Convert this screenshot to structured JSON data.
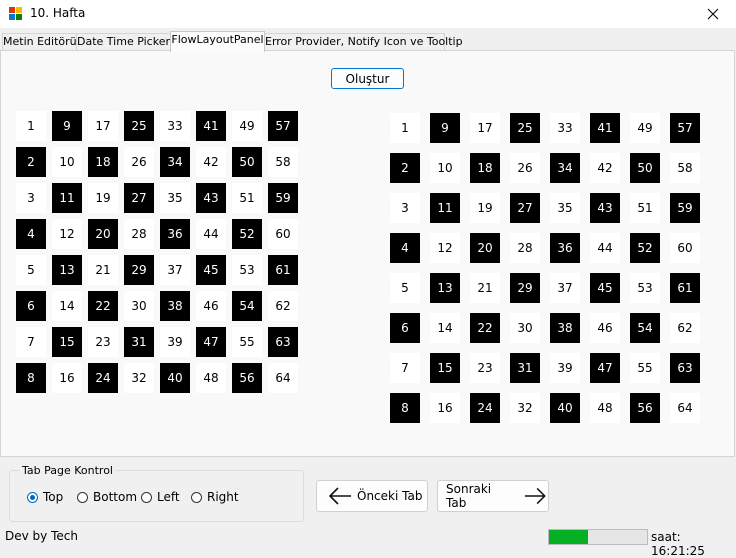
{
  "window": {
    "title": "10. Hafta"
  },
  "tabs": [
    {
      "label": "Metin Editörü",
      "selected": false
    },
    {
      "label": "Date Time Picker",
      "selected": false
    },
    {
      "label": "FlowLayoutPanel",
      "selected": true
    },
    {
      "label": "Error Provider, Notify Icon ve Tooltip",
      "selected": false
    }
  ],
  "panel": {
    "create_button": "Oluştur",
    "left_grid": {
      "count": 64,
      "dark_numbers": [
        2,
        4,
        6,
        8,
        9,
        11,
        13,
        15,
        18,
        20,
        22,
        24,
        25,
        27,
        29,
        31,
        34,
        36,
        38,
        40,
        41,
        43,
        45,
        47,
        50,
        52,
        54,
        56,
        57,
        59,
        61,
        63
      ]
    },
    "right_grid": {
      "count": 64,
      "dark_numbers": [
        2,
        4,
        6,
        8,
        9,
        11,
        13,
        15,
        18,
        20,
        22,
        24,
        25,
        27,
        29,
        31,
        34,
        36,
        38,
        40,
        41,
        43,
        45,
        47,
        50,
        52,
        54,
        56,
        57,
        59,
        61,
        63
      ]
    }
  },
  "tab_page_control": {
    "legend": "Tab Page Kontrol",
    "options": [
      {
        "label": "Top",
        "checked": true
      },
      {
        "label": "Bottom",
        "checked": false
      },
      {
        "label": "Left",
        "checked": false
      },
      {
        "label": "Right",
        "checked": false
      }
    ]
  },
  "navigation": {
    "prev_label": "Önceki Tab",
    "next_label": "Sonraki Tab"
  },
  "statusbar": {
    "left_text": "Dev by Tech",
    "progress": 0.4,
    "clock": "saat: 16:21:25"
  },
  "colors": {
    "accent": "#0078d4",
    "progress": "#06b025",
    "dark_cell": "#000000",
    "light_cell": "#ffffff"
  }
}
